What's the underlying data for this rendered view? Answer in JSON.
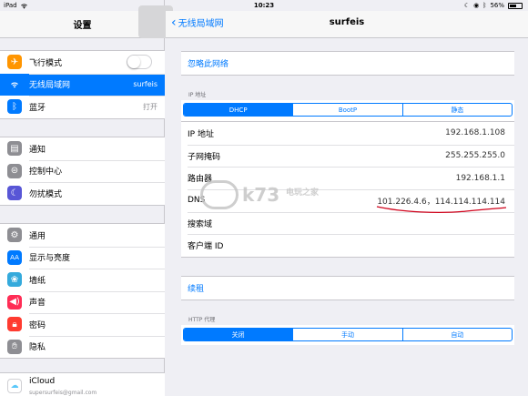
{
  "statusbar": {
    "device": "iPad",
    "time": "10:23",
    "battery": "56%",
    "battery_level": 0.56
  },
  "left": {
    "title": "设置",
    "groups": [
      [
        {
          "label": "飞行模式",
          "icon": "airplane-icon",
          "color": "#ff9500",
          "value": "",
          "toggle": true
        },
        {
          "label": "无线局域网",
          "icon": "wifi-icon",
          "color": "#007aff",
          "value": "surfeis",
          "selected": true
        },
        {
          "label": "蓝牙",
          "icon": "bluetooth-icon",
          "color": "#007aff",
          "value": "打开"
        }
      ],
      [
        {
          "label": "通知",
          "icon": "notifications-icon",
          "color": "#8e8e93"
        },
        {
          "label": "控制中心",
          "icon": "control-center-icon",
          "color": "#8e8e93"
        },
        {
          "label": "勿扰模式",
          "icon": "moon-icon",
          "color": "#5856d6"
        }
      ],
      [
        {
          "label": "通用",
          "icon": "gear-icon",
          "color": "#8e8e93"
        },
        {
          "label": "显示与亮度",
          "icon": "display-icon",
          "color": "#007aff"
        },
        {
          "label": "墙纸",
          "icon": "wallpaper-icon",
          "color": "#34aadc"
        },
        {
          "label": "声音",
          "icon": "sound-icon",
          "color": "#ff2d55"
        },
        {
          "label": "密码",
          "icon": "lock-icon",
          "color": "#ff3b30"
        },
        {
          "label": "隐私",
          "icon": "hand-icon",
          "color": "#8e8e93"
        }
      ]
    ],
    "icloud": {
      "title": "iCloud",
      "subtitle": "supersurfeis@gmail.com"
    }
  },
  "right": {
    "back_label": "无线局域网",
    "title": "surfeis",
    "forget": "忽略此网络",
    "ip_section": "IP 地址",
    "ip_modes": [
      "DHCP",
      "BootP",
      "静态"
    ],
    "ip_mode_active": 0,
    "rows": [
      {
        "label": "IP 地址",
        "value": "192.168.1.108"
      },
      {
        "label": "子网掩码",
        "value": "255.255.255.0"
      },
      {
        "label": "路由器",
        "value": "192.168.1.1"
      },
      {
        "label": "DNS",
        "value": "101.226.4.6，114.114.114.114"
      },
      {
        "label": "搜索域",
        "value": ""
      },
      {
        "label": "客户端 ID",
        "value": ""
      }
    ],
    "renew": "续租",
    "http_section": "HTTP 代理",
    "proxy_modes": [
      "关闭",
      "手动",
      "自动"
    ],
    "proxy_mode_active": 0
  },
  "watermark": {
    "text": "k73",
    "sub": "电玩之家"
  },
  "colors": {
    "accent": "#007aff",
    "annotation": "#d0021b"
  }
}
